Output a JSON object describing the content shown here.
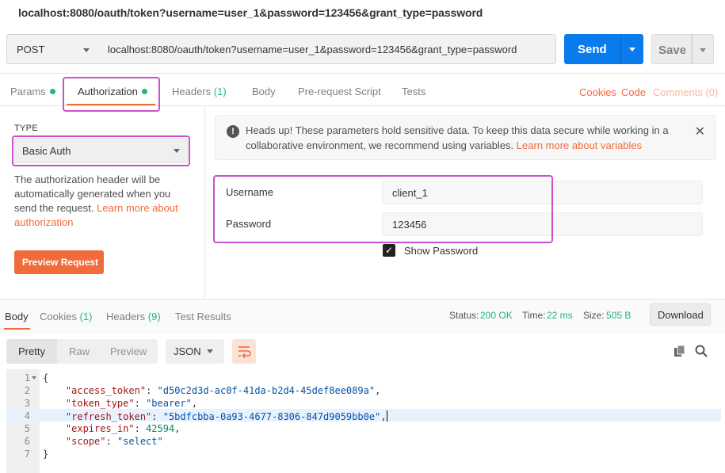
{
  "window": {
    "title": "localhost:8080/oauth/token?username=user_1&password=123456&grant_type=password"
  },
  "request": {
    "method": "POST",
    "url": "localhost:8080/oauth/token?username=user_1&password=123456&grant_type=password",
    "send_label": "Send",
    "save_label": "Save"
  },
  "tabs": {
    "params": "Params",
    "authorization": "Authorization",
    "headers": "Headers",
    "headers_count": "(1)",
    "body": "Body",
    "prerequest": "Pre-request Script",
    "tests": "Tests",
    "cookies": "Cookies",
    "code": "Code",
    "comments": "Comments (0)"
  },
  "auth": {
    "type_label": "TYPE",
    "type_value": "Basic Auth",
    "description": "The authorization header will be automatically generated when you send the request.",
    "learn_more": "Learn more about authorization",
    "preview_button": "Preview Request"
  },
  "warning": {
    "text": "Heads up! These parameters hold sensitive data. To keep this data secure while working in a collaborative environment, we recommend using variables.",
    "link": "Learn more about variables",
    "icon": "exclamation-icon",
    "close_icon": "close-icon"
  },
  "credentials": {
    "username_label": "Username",
    "username_value": "client_1",
    "password_label": "Password",
    "password_value": "123456",
    "show_password_label": "Show Password",
    "show_password_checked": true
  },
  "response": {
    "tabs": {
      "body": "Body",
      "cookies": "Cookies",
      "cookies_count": "(1)",
      "headers": "Headers",
      "headers_count": "(9)",
      "test_results": "Test Results"
    },
    "status_label": "Status:",
    "status_value": "200 OK",
    "time_label": "Time:",
    "time_value": "22 ms",
    "size_label": "Size:",
    "size_value": "505 B",
    "download_label": "Download",
    "format": {
      "pretty": "Pretty",
      "raw": "Raw",
      "preview": "Preview",
      "type": "JSON"
    }
  },
  "code": {
    "line_numbers": [
      "1",
      "2",
      "3",
      "4",
      "5",
      "6",
      "7"
    ],
    "open_brace": "{",
    "close_brace": "}",
    "access_token_key": "\"access_token\"",
    "access_token_value": "\"d50c2d3d-ac0f-41da-b2d4-45def8ee089a\"",
    "token_type_key": "\"token_type\"",
    "token_type_value": "\"bearer\"",
    "refresh_token_key": "\"refresh_token\"",
    "refresh_token_value": "\"5bdfcbba-0a93-4677-8306-847d9059bb0e\"",
    "expires_in_key": "\"expires_in\"",
    "expires_in_value": "42594",
    "scope_key": "\"scope\"",
    "scope_value": "\"select\""
  },
  "colors": {
    "accent_orange": "#f26b3a",
    "send_blue": "#097bed",
    "status_green": "#26b47f",
    "annotation_magenta": "#c951c9"
  }
}
